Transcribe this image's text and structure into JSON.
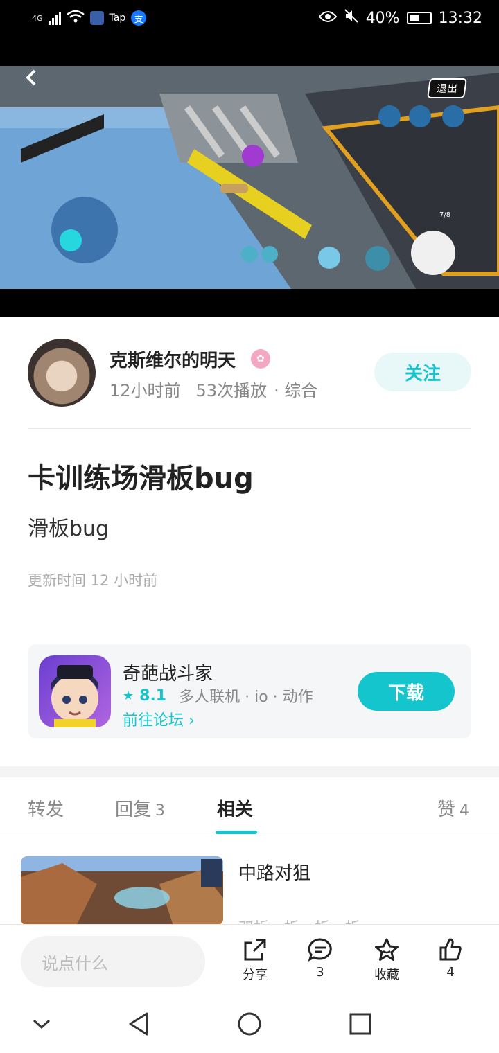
{
  "status_bar": {
    "network": "4G",
    "tap_label": "Tap",
    "alipay_glyph": "支",
    "battery": "40%",
    "time": "13:32"
  },
  "video": {
    "exit_label": "退出",
    "counter": "7/8"
  },
  "author": {
    "name": "克斯维尔的明天",
    "time_ago": "12小时前",
    "plays": "53次播放",
    "category": "· 综合",
    "follow_label": "关注"
  },
  "post": {
    "title": "卡训练场滑板bug",
    "body": "滑板bug",
    "updated": "更新时间 12 小时前"
  },
  "game": {
    "name": "奇葩战斗家",
    "rating": "8.1",
    "tags": "多人联机 · io · 动作",
    "forum_link": "前往论坛",
    "download_label": "下载"
  },
  "tabs": {
    "forward": "转发",
    "reply": "回复",
    "reply_count": "3",
    "related": "相关",
    "like": "赞",
    "like_count": "4"
  },
  "related": {
    "title": "中路对狙",
    "subtitle": "双折一拆一拆一拆"
  },
  "bottom_bar": {
    "comment_placeholder": "说点什么",
    "share_label": "分享",
    "comment_count": "3",
    "favorite_label": "收藏",
    "like_count": "4"
  },
  "colors": {
    "accent": "#15c5ce",
    "follow_bg": "#e8f7f7"
  },
  "icons": {
    "back": "back-arrow-icon",
    "share": "share-icon",
    "comment": "comment-icon",
    "favorite": "star-icon",
    "like": "thumbs-up-icon"
  }
}
